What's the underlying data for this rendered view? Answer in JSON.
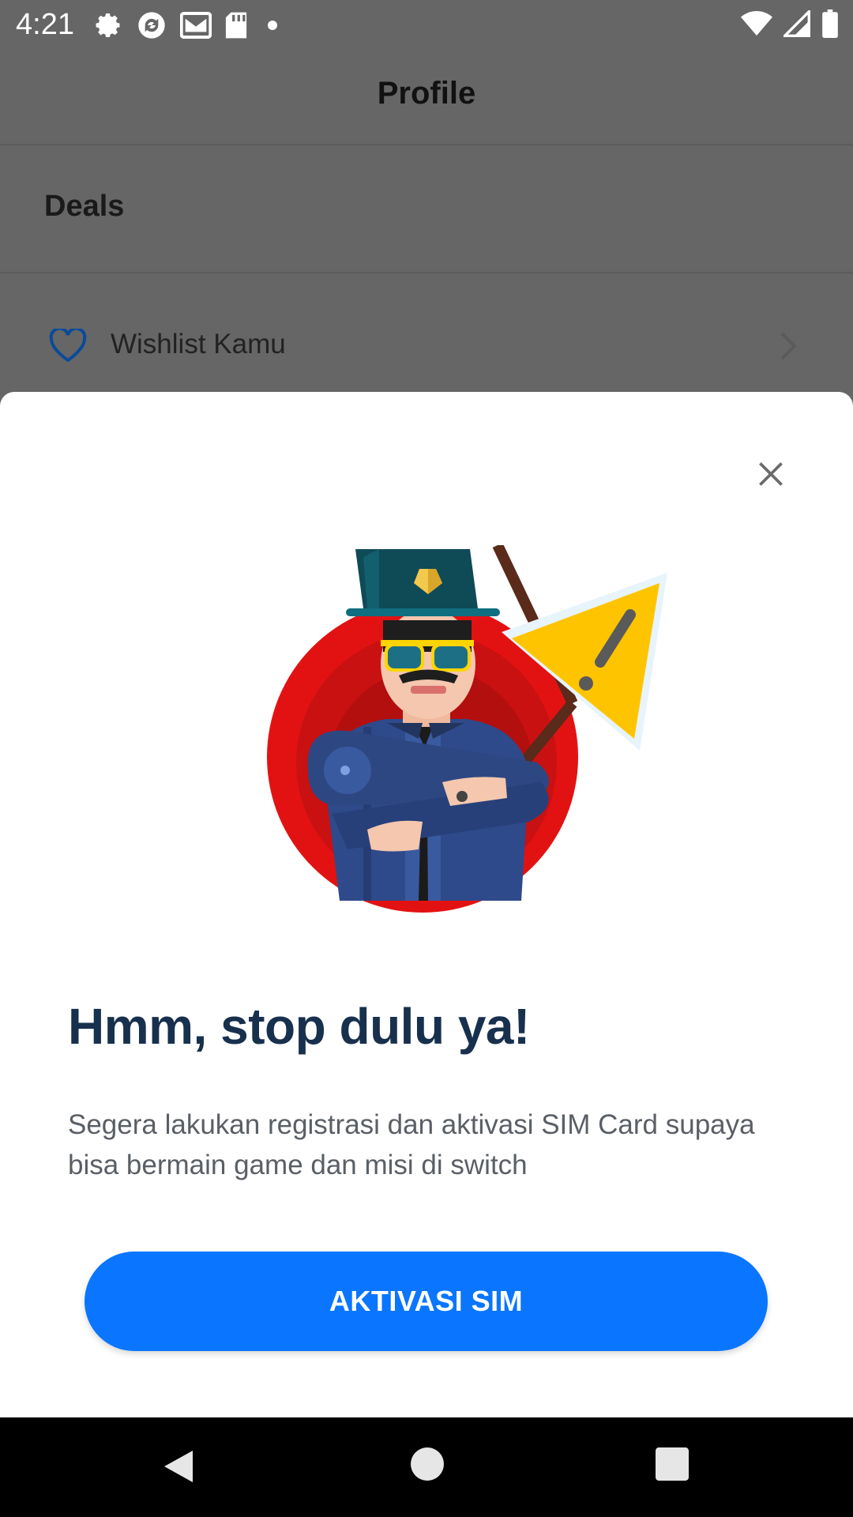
{
  "status_bar": {
    "time": "4:21",
    "left_icons": [
      "gear-icon",
      "sync-icon",
      "mail-icon",
      "sd-card-icon",
      "dot-icon"
    ],
    "right_icons": [
      "wifi-icon",
      "signal-icon",
      "battery-icon"
    ]
  },
  "background": {
    "header_title": "Profile",
    "section_label": "Deals",
    "wishlist_label": "Wishlist Kamu"
  },
  "sheet": {
    "title": "Hmm, stop dulu ya!",
    "description": "Segera lakukan registrasi dan aktivasi SIM Card supaya bisa bermain game dan misi di switch",
    "button_label": "AKTIVASI SIM",
    "button_color": "#0a76ff",
    "title_color": "#17304d"
  },
  "nav_bar": {
    "buttons": [
      "back-icon",
      "home-icon",
      "recents-icon"
    ]
  }
}
